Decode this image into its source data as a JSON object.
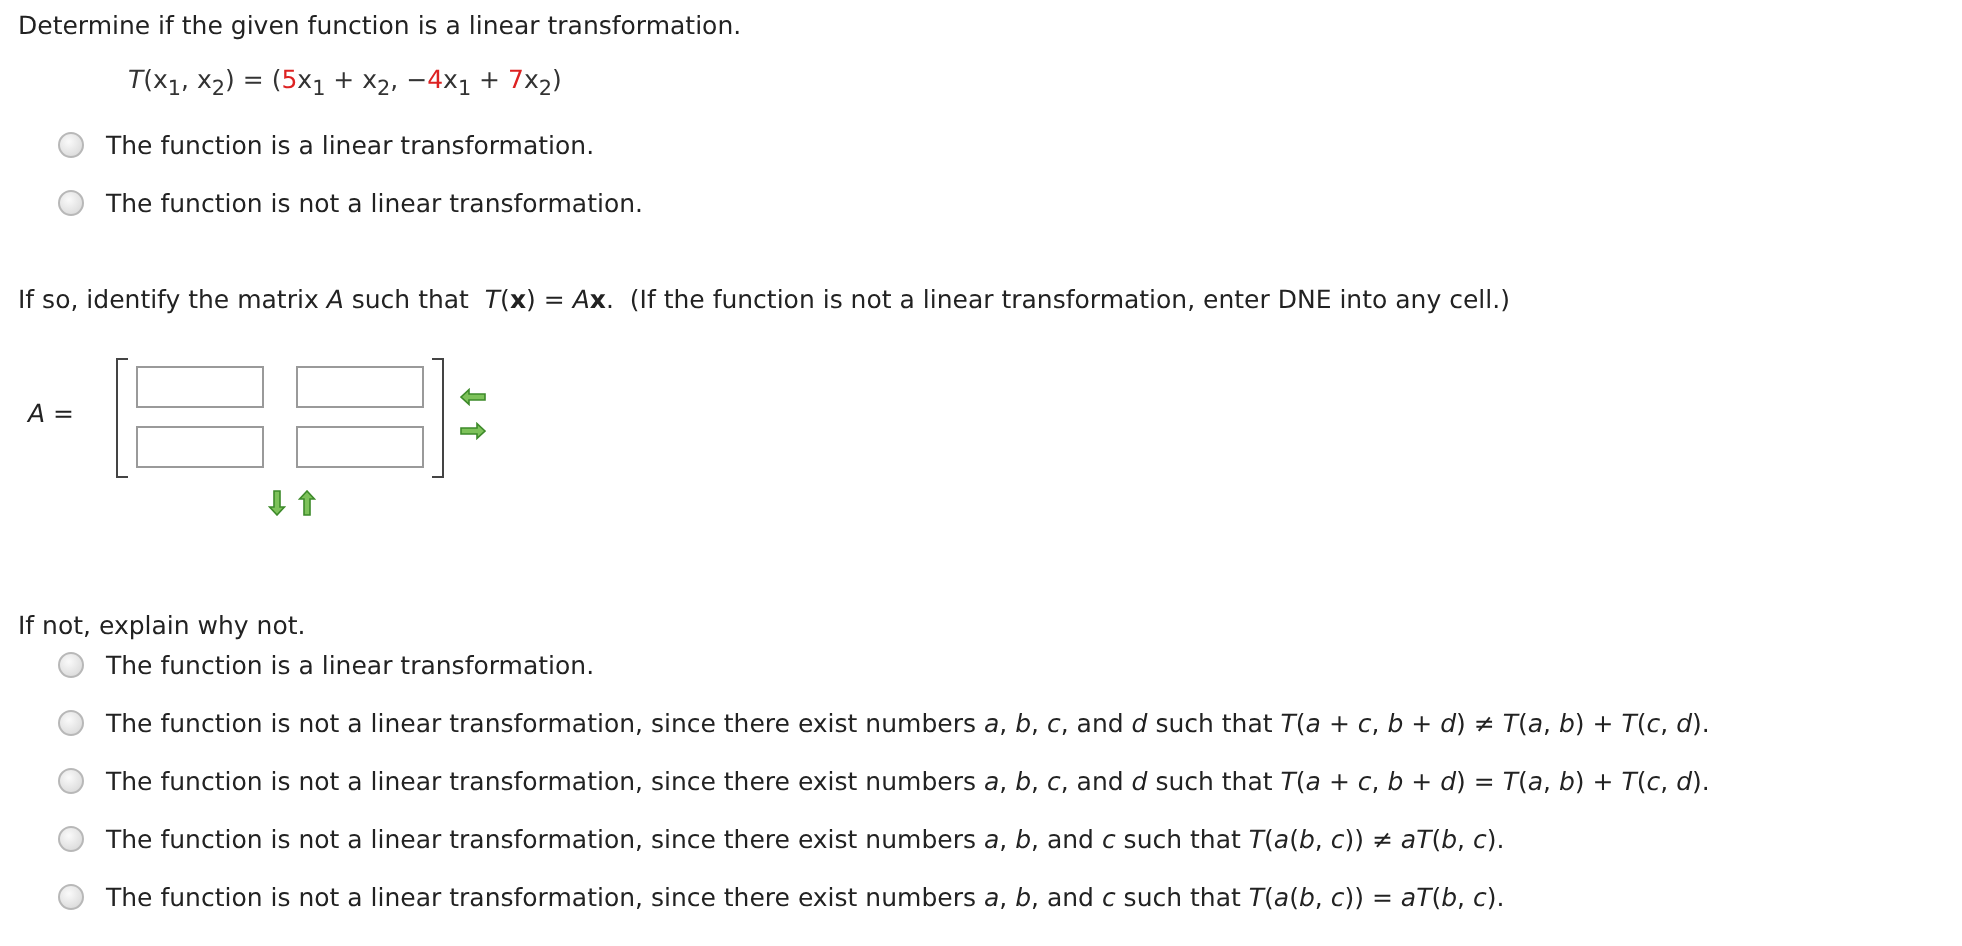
{
  "question": "Determine if the given function is a linear transformation.",
  "equation": [
    {
      "text": "*T*(x$_{1}$, x$_{2}$) = (",
      "color": "#333333"
    },
    {
      "text": "5",
      "color": "#dd2222"
    },
    {
      "text": "x$_{1}$ + x$_{2}$, −",
      "color": "#333333"
    },
    {
      "text": "4",
      "color": "#dd2222"
    },
    {
      "text": "x$_{1}$ + ",
      "color": "#333333"
    },
    {
      "text": "7",
      "color": "#dd2222"
    },
    {
      "text": "x$_{2}$)",
      "color": "#333333"
    }
  ],
  "choices_1": [
    {
      "label": "The function is a linear transformation.",
      "selected": false
    },
    {
      "label": "The function is not a linear transformation.",
      "selected": false
    }
  ],
  "matrix_prompt": [
    "If so, identify the matrix *A* such that  *T*(**x**) = *A*",
    "**x**.  (If the function is not a linear transformation, enter DNE into any cell.)"
  ],
  "matrix": {
    "label": "*A* =",
    "cells": [
      [
        {
          "kind": "input"
        },
        {
          "kind": "input"
        }
      ],
      [
        {
          "kind": "input"
        },
        {
          "kind": "input"
        }
      ]
    ]
  },
  "explain_prompt": "If not, explain why not.",
  "choices_2": [
    {
      "label": "The function is a linear transformation.",
      "selected": false
    },
    {
      "label": "The function is not a linear transformation, since there exist numbers *a*, *b*, *c*, and *d* such that *T*(*a* + *c*, *b* + *d*) ≠ *T*(*a*, *b*) + *T*(*c*, *d*).",
      "selected": false
    },
    {
      "label": "The function is not a linear transformation, since there exist numbers *a*, *b*, *c*, and *d* such that *T*(*a* + *c*, *b* + *d*) = *T*(*a*, *b*) + *T*(*c*, *d*).",
      "selected": false
    },
    {
      "label": "The function is not a linear transformation, since there exist numbers *a*, *b*, and *c* such that *T*(*a*(*b*, *c*)) ≠ *aT*(*b*, *c*).",
      "selected": false
    },
    {
      "label": "The function is not a linear transformation, since there exist numbers *a*, *b*, and *c* such that *T*(*a*(*b*, *c*)) = *aT*(*b*, *c*).",
      "selected": false
    }
  ]
}
